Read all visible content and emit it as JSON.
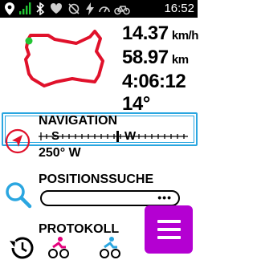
{
  "status_bar": {
    "time": "16:52",
    "icons": [
      "map-marker-icon",
      "signal-icon",
      "bluetooth-icon",
      "heart-icon",
      "no-sync-icon",
      "flash-icon",
      "speedometer-icon",
      "bike-icon"
    ]
  },
  "stats": {
    "distance_value": "14.37",
    "distance_unit": "km/h",
    "speed_value": "58.97",
    "speed_unit": "km",
    "duration": "4:06:12",
    "temperature": "14°"
  },
  "navigation": {
    "title": "NAVIGATION",
    "heading": "250° W",
    "compass_labels": [
      "S",
      "W"
    ]
  },
  "position_search": {
    "title": "POSITIONSSUCHE",
    "dots": "•••"
  },
  "protocol": {
    "title": "PROTOKOLL",
    "icons": [
      "history-icon",
      "bike-icon",
      "bike-icon",
      "bike-icon"
    ]
  },
  "colors": {
    "accent_blue": "#2aa6e0",
    "track_red": "#e0112b",
    "menu_purple": "#b400d2",
    "status_green": "#22c533"
  }
}
